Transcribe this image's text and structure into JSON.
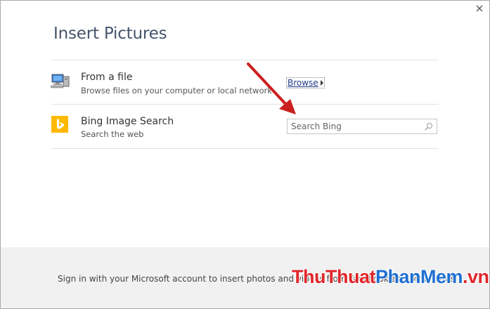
{
  "dialog": {
    "title": "Insert Pictures",
    "close_icon": "close-icon"
  },
  "from_file": {
    "title": "From a file",
    "subtitle": "Browse files on your computer or local network",
    "action_label": "Browse",
    "icon": "computer-icon"
  },
  "bing": {
    "title": "Bing Image Search",
    "subtitle": "Search the web",
    "search_placeholder": "Search Bing",
    "icon": "bing-logo-icon",
    "brand_color": "#ffb900"
  },
  "footer": {
    "text": "Sign in with your Microsoft account to insert photos and videos from Facebook and other sites."
  },
  "watermark": {
    "part1": "ThuThuat",
    "part2": "PhanMem",
    "part3": ".vn"
  },
  "colors": {
    "annotation_arrow": "#cc1f1f",
    "title": "#44546a"
  }
}
